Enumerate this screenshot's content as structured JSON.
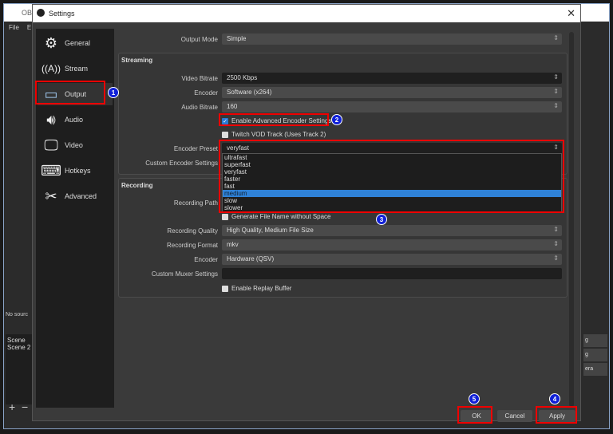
{
  "main_window": {
    "title": "OBS",
    "menu": [
      "File",
      "E"
    ],
    "sources_status": "No sourc",
    "scenes": [
      "Scene",
      "Scene 2"
    ],
    "right_dock_items": [
      "g",
      "g",
      "era"
    ]
  },
  "dialog": {
    "title": "Settings",
    "close": "✕"
  },
  "sidebar": {
    "items": [
      {
        "label": "General",
        "icon": "gear-icon"
      },
      {
        "label": "Stream",
        "icon": "antenna-icon"
      },
      {
        "label": "Output",
        "icon": "output-monitor-icon"
      },
      {
        "label": "Audio",
        "icon": "speaker-icon"
      },
      {
        "label": "Video",
        "icon": "monitor-icon"
      },
      {
        "label": "Hotkeys",
        "icon": "keyboard-icon"
      },
      {
        "label": "Advanced",
        "icon": "tools-icon"
      }
    ],
    "selected": "Output"
  },
  "output_mode": {
    "label": "Output Mode",
    "value": "Simple"
  },
  "streaming": {
    "title": "Streaming",
    "video_bitrate_label": "Video Bitrate",
    "video_bitrate": "2500 Kbps",
    "encoder_label": "Encoder",
    "encoder": "Software (x264)",
    "audio_bitrate_label": "Audio Bitrate",
    "audio_bitrate": "160",
    "advanced_encoder": "Enable Advanced Encoder Settings",
    "advanced_encoder_checked": true,
    "twitch_vod": "Twitch VOD Track (Uses Track 2)",
    "twitch_vod_checked": false,
    "preset_label": "Encoder Preset",
    "preset": "veryfast",
    "custom_label": "Custom Encoder Settings",
    "preset_options": [
      "ultrafast",
      "superfast",
      "veryfast",
      "faster",
      "fast",
      "medium",
      "slow",
      "slower"
    ],
    "highlighted_option": "medium"
  },
  "recording": {
    "title": "Recording",
    "path_label": "Recording Path",
    "no_space": "Generate File Name without Space",
    "quality_label": "Recording Quality",
    "quality": "High Quality, Medium File Size",
    "format_label": "Recording Format",
    "format": "mkv",
    "encoder_label": "Encoder",
    "encoder": "Hardware (QSV)",
    "muxer_label": "Custom Muxer Settings",
    "muxer": "",
    "replay": "Enable Replay Buffer"
  },
  "buttons": {
    "ok": "OK",
    "cancel": "Cancel",
    "apply": "Apply"
  },
  "badges": [
    "1",
    "2",
    "3",
    "4",
    "5"
  ],
  "colors": {
    "highlight": "#ee0000",
    "badge": "#1020d8",
    "selection": "#2f82d8"
  }
}
